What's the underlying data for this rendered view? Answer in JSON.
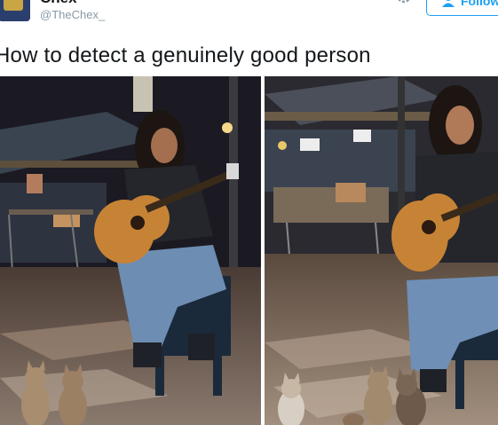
{
  "author": {
    "name": "Chex",
    "handle": "@TheChex_"
  },
  "actions": {
    "settings_icon": "gear-icon",
    "follow_label": "Follow",
    "follow_icon": "add-person-icon"
  },
  "tweet": {
    "text": "How to detect a genuinely good person"
  },
  "media": {
    "photos": [
      {
        "scene": "man playing guitar at night market with two cats watching"
      },
      {
        "scene": "man playing guitar with several cats gathered in front"
      }
    ]
  },
  "colors": {
    "accent": "#1da1f2",
    "text": "#14171a",
    "muted": "#8899a6"
  }
}
